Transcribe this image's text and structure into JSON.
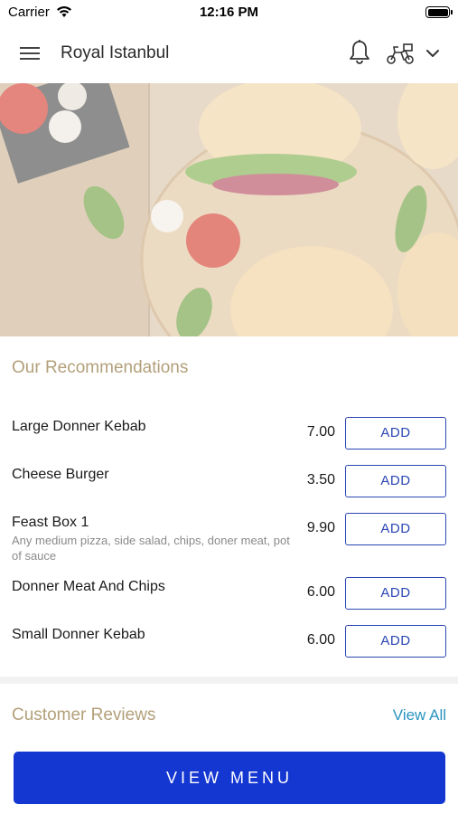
{
  "status_bar": {
    "carrier": "Carrier",
    "time": "12:16 PM"
  },
  "header": {
    "title": "Royal Istanbul",
    "icons": [
      "menu-icon",
      "bell-icon",
      "delivery-icon",
      "chevron-down-icon"
    ]
  },
  "hero": {
    "image_icon": "food-photo"
  },
  "recommendations": {
    "title": "Our Recommendations",
    "items": [
      {
        "name": "Large Donner Kebab",
        "price": "7.00",
        "add_label": "ADD"
      },
      {
        "name": "Cheese Burger",
        "price": "3.50",
        "add_label": "ADD"
      },
      {
        "name": "Feast Box 1",
        "description": "Any medium pizza, side salad, chips, doner meat, pot of sauce",
        "price": "9.90",
        "add_label": "ADD"
      },
      {
        "name": "Donner Meat And Chips",
        "price": "6.00",
        "add_label": "ADD"
      },
      {
        "name": "Small Donner Kebab",
        "price": "6.00",
        "add_label": "ADD"
      }
    ]
  },
  "reviews": {
    "title": "Customer Reviews",
    "view_all_label": "View All"
  },
  "footer": {
    "view_menu_label": "VIEW MENU"
  },
  "colors": {
    "accent": "#1436d1",
    "add_border": "#2b47b3",
    "section_title": "#b3a07a",
    "link": "#2a94c0"
  }
}
